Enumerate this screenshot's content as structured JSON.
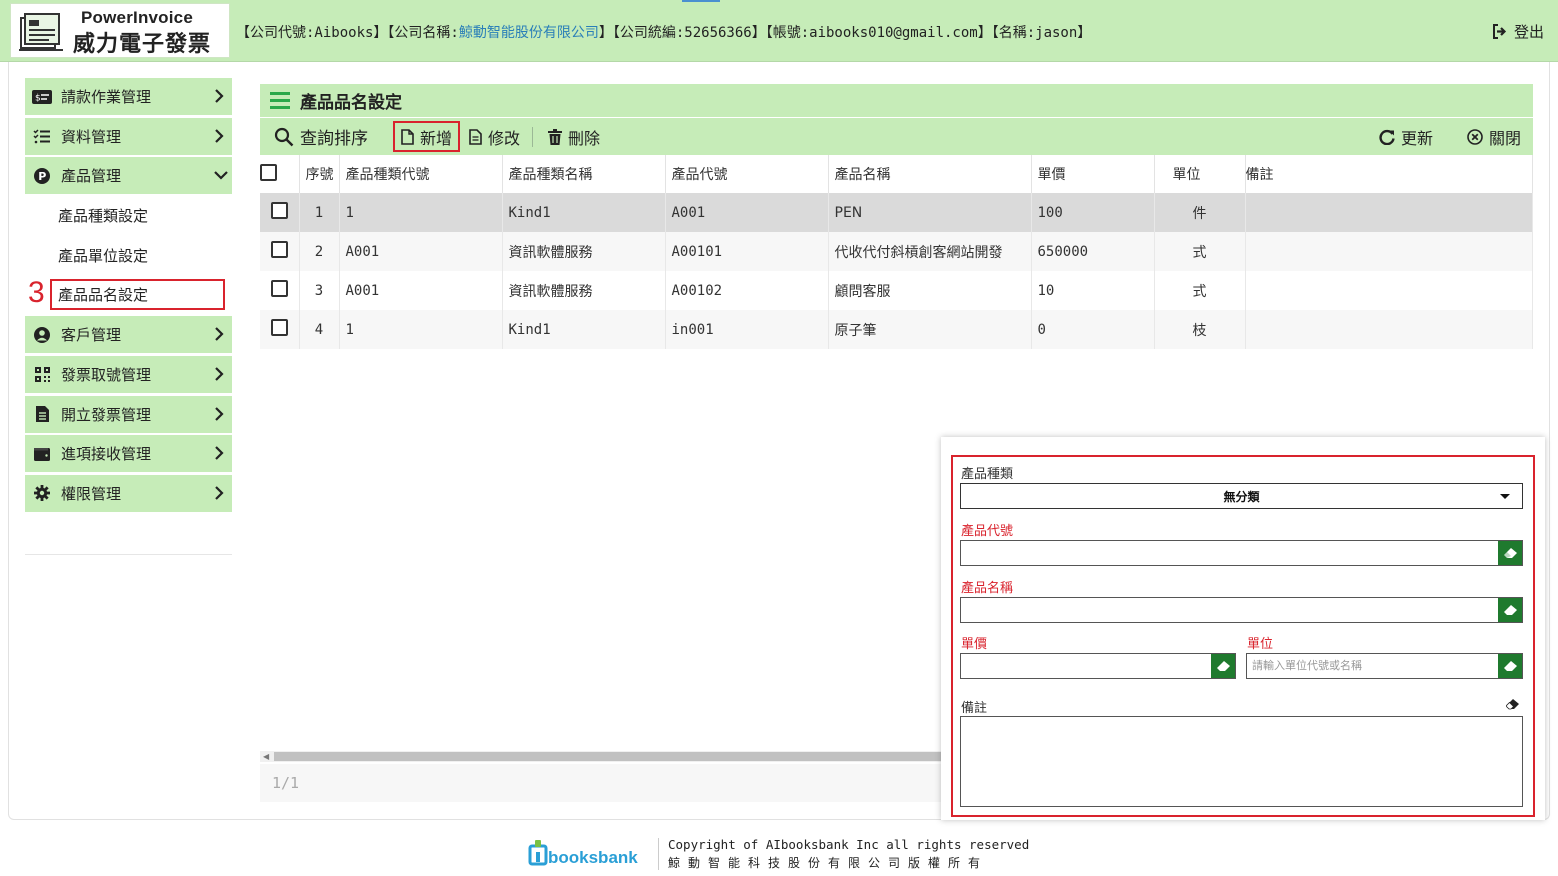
{
  "header": {
    "brand_en": "PowerInvoice",
    "brand_zh": "威力電子發票",
    "company_prefix": "【公司代號:Aibooks】【公司名稱:",
    "company_name": "鯨動智能股份有限公司",
    "company_suffix": "】【公司統編:52656366】【帳號:aibooks010@gmail.com】【名稱:jason】",
    "logout_label": "登出"
  },
  "sidebar": {
    "items": [
      {
        "label": "請款作業管理",
        "icon": "invoice-card-icon"
      },
      {
        "label": "資料管理",
        "icon": "checklist-icon"
      },
      {
        "label": "產品管理",
        "icon": "p-circle-icon"
      }
    ],
    "sub_items": [
      {
        "label": "產品種類設定"
      },
      {
        "label": "產品單位設定"
      },
      {
        "label": "產品品名設定",
        "step": "3"
      }
    ],
    "items_after": [
      {
        "label": "客戶管理",
        "icon": "user-circle-icon"
      },
      {
        "label": "發票取號管理",
        "icon": "qrcode-icon"
      },
      {
        "label": "開立發票管理",
        "icon": "document-icon"
      },
      {
        "label": "進項接收管理",
        "icon": "wallet-icon"
      },
      {
        "label": "權限管理",
        "icon": "gear-icon"
      }
    ]
  },
  "page": {
    "title": "產品品名設定"
  },
  "toolbar": {
    "search_label": "查詢排序",
    "add_label": "新增",
    "edit_label": "修改",
    "delete_label": "刪除",
    "refresh_label": "更新",
    "close_label": "關閉"
  },
  "table": {
    "columns": [
      "序號",
      "產品種類代號",
      "產品種類名稱",
      "產品代號",
      "產品名稱",
      "單價",
      "單位",
      "備註"
    ],
    "rows": [
      {
        "seq": "1",
        "type_code": "1",
        "type_name": "Kind1",
        "code": "A001",
        "name": "PEN",
        "price": "100",
        "unit": "件",
        "note": ""
      },
      {
        "seq": "2",
        "type_code": "A001",
        "type_name": "資訊軟體服務",
        "code": "A00101",
        "name": "代收代付斜槓創客網站開發",
        "price": "650000",
        "unit": "式",
        "note": ""
      },
      {
        "seq": "3",
        "type_code": "A001",
        "type_name": "資訊軟體服務",
        "code": "A00102",
        "name": "顧問客服",
        "price": "10",
        "unit": "式",
        "note": ""
      },
      {
        "seq": "4",
        "type_code": "1",
        "type_name": "Kind1",
        "code": "in001",
        "name": "原子筆",
        "price": "0",
        "unit": "枝",
        "note": ""
      }
    ],
    "pager": "1/1"
  },
  "form": {
    "type_label": "產品種類",
    "type_value": "無分類",
    "code_label": "產品代號",
    "code_value": "",
    "name_label": "產品名稱",
    "name_value": "",
    "price_label": "單價",
    "price_value": "",
    "unit_label": "單位",
    "unit_placeholder": "請輸入單位代號或名稱",
    "note_label": "備註",
    "note_value": ""
  },
  "footer": {
    "brand": "AIbooksbank",
    "copyright": "Copyright of AIbooksbank Inc all rights reserved",
    "company_zh": "鯨動智能科技股份有限公司版權所有"
  },
  "colors": {
    "header_green": "#c6ecb8",
    "highlight_red": "#d9232d",
    "erase_green": "#1f7a2e",
    "link_blue": "#2a7fb8"
  }
}
